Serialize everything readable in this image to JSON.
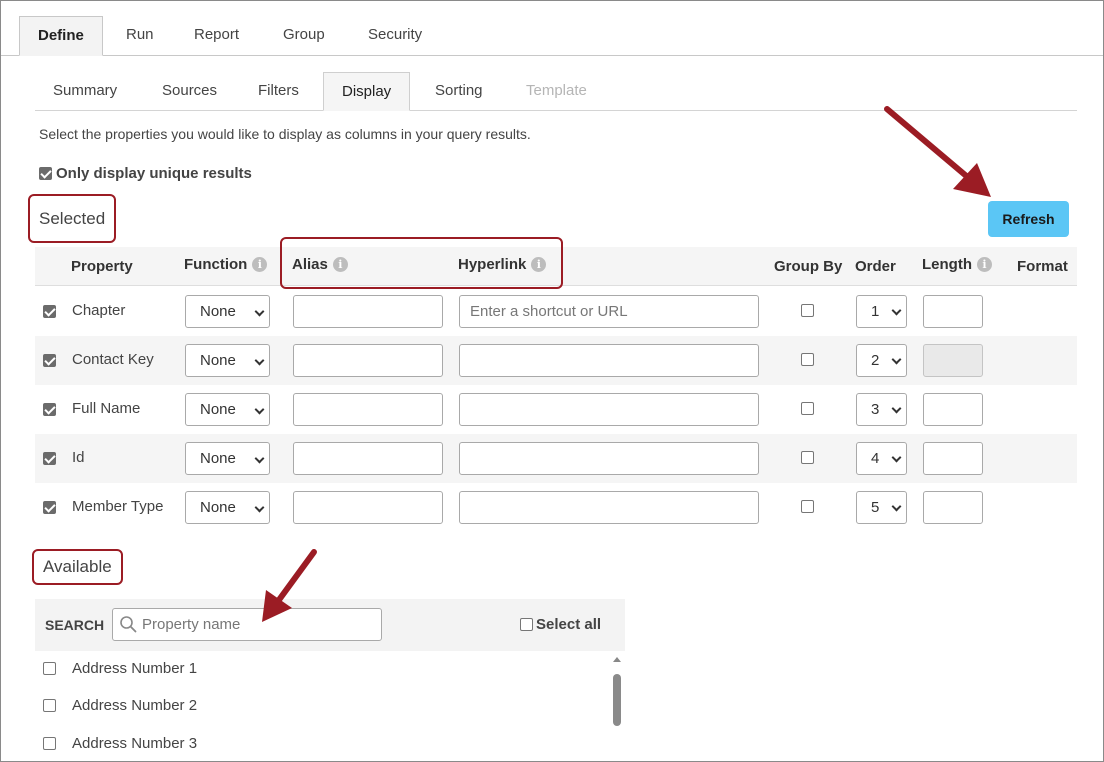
{
  "top_tabs": [
    {
      "label": "Define",
      "active": true
    },
    {
      "label": "Run"
    },
    {
      "label": "Report"
    },
    {
      "label": "Group"
    },
    {
      "label": "Security"
    }
  ],
  "sub_tabs": [
    {
      "label": "Summary"
    },
    {
      "label": "Sources"
    },
    {
      "label": "Filters"
    },
    {
      "label": "Display",
      "active": true
    },
    {
      "label": "Sorting"
    },
    {
      "label": "Template",
      "disabled": true
    }
  ],
  "instructions": "Select the properties you would like to display as columns in your query results.",
  "unique_results": {
    "label": "Only display unique results",
    "checked": true
  },
  "selected": {
    "heading": "Selected",
    "refresh_label": "Refresh",
    "columns": {
      "property": "Property",
      "function": "Function",
      "alias": "Alias",
      "hyperlink": "Hyperlink",
      "group_by": "Group By",
      "order": "Order",
      "length": "Length",
      "format": "Format"
    },
    "hyperlink_placeholder": "Enter a shortcut or URL",
    "rows": [
      {
        "property": "Chapter",
        "function": "None",
        "order": "1",
        "checked": true
      },
      {
        "property": "Contact Key",
        "function": "None",
        "order": "2",
        "checked": true
      },
      {
        "property": "Full Name",
        "function": "None",
        "order": "3",
        "checked": true
      },
      {
        "property": "Id",
        "function": "None",
        "order": "4",
        "checked": true
      },
      {
        "property": "Member Type",
        "function": "None",
        "order": "5",
        "checked": true
      }
    ]
  },
  "available": {
    "heading": "Available",
    "search_label": "SEARCH",
    "search_placeholder": "Property name",
    "select_all_label": "Select all",
    "items": [
      "Address Number 1",
      "Address Number 2",
      "Address Number 3"
    ]
  },
  "colors": {
    "highlight": "#9b1c24",
    "refresh_button": "#5bc6f5"
  }
}
